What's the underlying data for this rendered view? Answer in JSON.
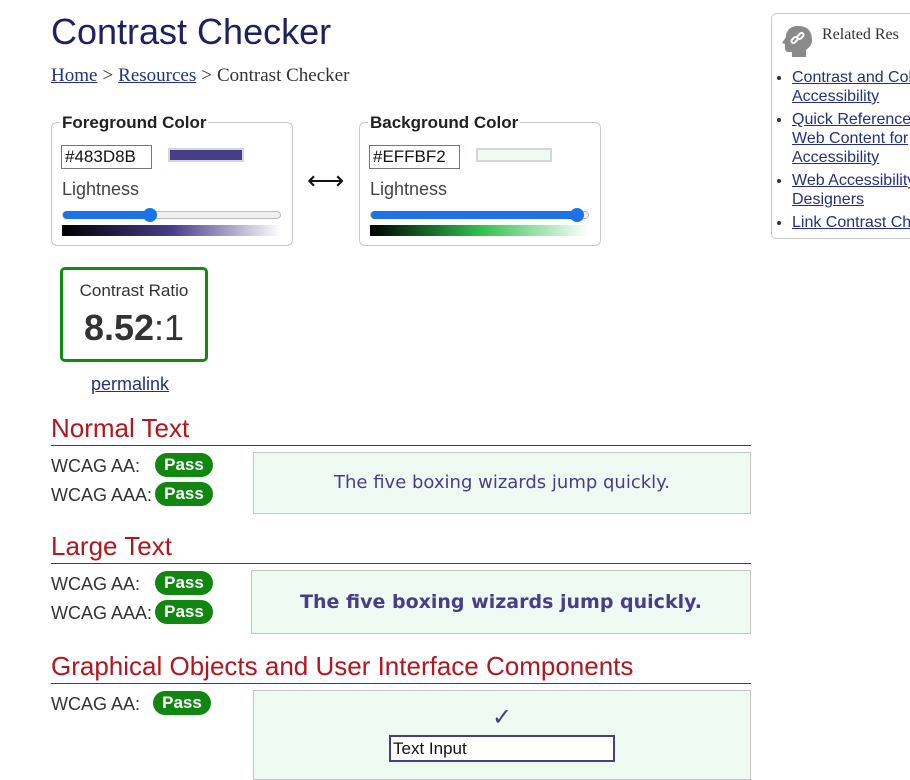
{
  "page": {
    "title": "Contrast Checker"
  },
  "breadcrumb": {
    "home": "Home",
    "resources": "Resources",
    "current": "Contrast Checker",
    "separator": ">"
  },
  "foreground": {
    "legend": "Foreground Color",
    "hex": "#483D8B",
    "color": "#483D8B",
    "lightness_label": "Lightness",
    "lightness": 0.4,
    "gradient": [
      "#000000",
      "#483D8B",
      "#ffffff"
    ]
  },
  "background": {
    "legend": "Background Color",
    "hex": "#EFFBF2",
    "color": "#EFFBF2",
    "lightness_label": "Lightness",
    "lightness": 0.95,
    "gradient": [
      "#000000",
      "#2fbf4f",
      "#ffffff"
    ]
  },
  "swap_icon": {
    "icon": "swap-arrows-icon",
    "glyph": "⟷"
  },
  "contrast": {
    "label": "Contrast Ratio",
    "ratio_main": "8.52",
    "ratio_suffix": ":1",
    "border_color": "#138A13"
  },
  "permalink": "permalink",
  "sections": {
    "normal": {
      "heading": "Normal Text",
      "aa_label": "WCAG AA:",
      "aa_result": "Pass",
      "aaa_label": "WCAG AAA:",
      "aaa_result": "Pass",
      "sample": "The five boxing wizards jump quickly."
    },
    "large": {
      "heading": "Large Text",
      "aa_label": "WCAG AA:",
      "aa_result": "Pass",
      "aaa_label": "WCAG AAA:",
      "aaa_result": "Pass",
      "sample": "The five boxing wizards jump quickly."
    },
    "graphical": {
      "heading": "Graphical Objects and User Interface Components",
      "aa_label": "WCAG AA:",
      "aa_result": "Pass",
      "check_glyph": "✓",
      "input_text": "Text Input"
    }
  },
  "colors": {
    "pass": "#118611",
    "section_heading": "#B0171F",
    "link": "#26317C"
  },
  "sidebar": {
    "title": "Related Res",
    "icon": "chain-link-icon",
    "links": [
      [
        "Contrast and Col",
        "Accessibility"
      ],
      [
        "Quick Reference:",
        "Web Content for",
        "Accessibility"
      ],
      [
        "Web Accessibility",
        "Designers"
      ],
      [
        "Link Contrast Ch"
      ]
    ]
  }
}
